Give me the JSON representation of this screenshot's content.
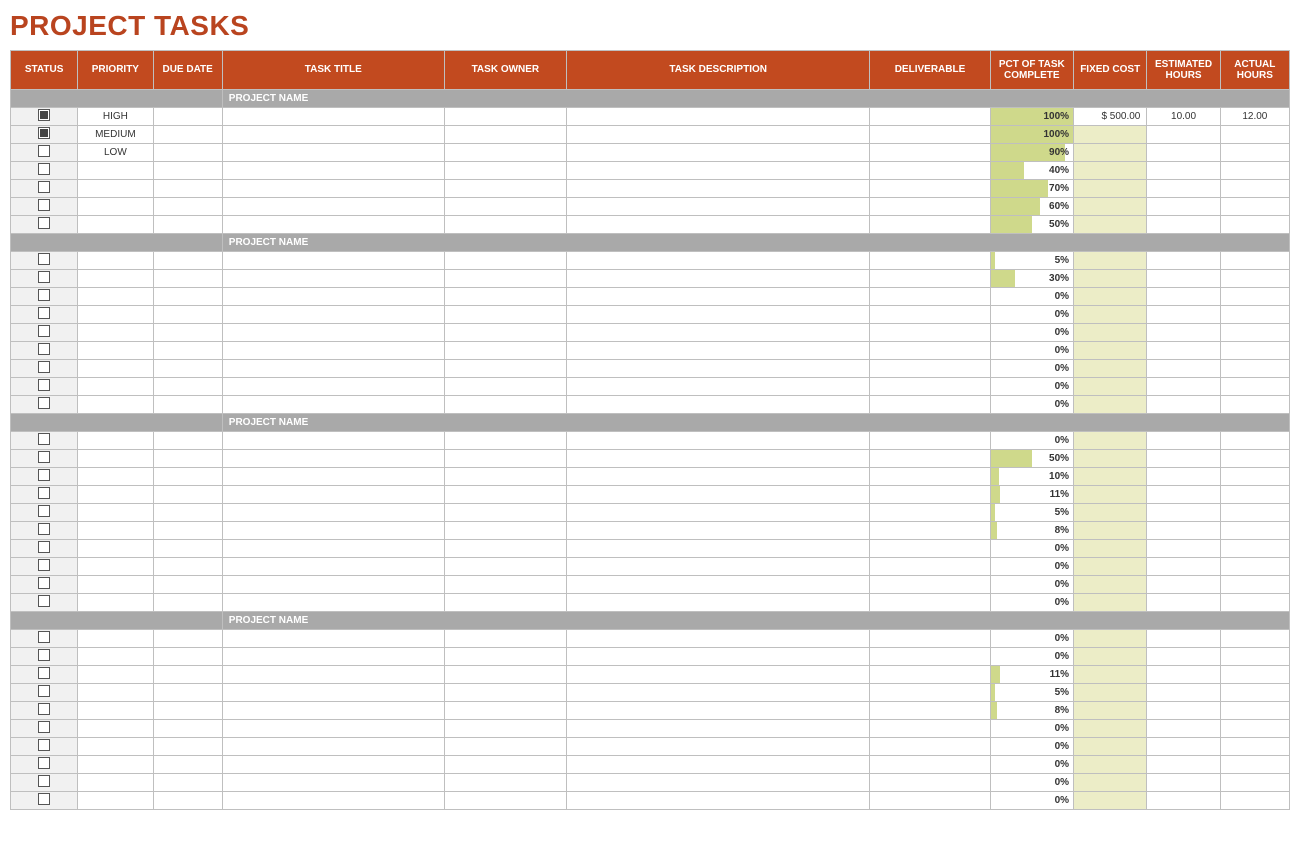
{
  "title": "PROJECT TASKS",
  "columns": {
    "status": "STATUS",
    "priority": "PRIORITY",
    "due_date": "DUE DATE",
    "task_title": "TASK TITLE",
    "task_owner": "TASK OWNER",
    "task_description": "TASK DESCRIPTION",
    "deliverable": "DELIVERABLE",
    "pct_complete": "PCT OF TASK COMPLETE",
    "fixed_cost": "FIXED COST",
    "est_hours": "ESTIMATED HOURS",
    "act_hours": "ACTUAL HOURS"
  },
  "section_label": "PROJECT NAME",
  "sections": [
    {
      "rows": [
        {
          "checked": true,
          "priority": "HIGH",
          "pct": 100,
          "fixed_cost": "$      500.00",
          "est_hours": "10.00",
          "act_hours": "12.00"
        },
        {
          "checked": true,
          "priority": "MEDIUM",
          "pct": 100
        },
        {
          "checked": false,
          "priority": "LOW",
          "pct": 90
        },
        {
          "checked": false,
          "pct": 40
        },
        {
          "checked": false,
          "pct": 70
        },
        {
          "checked": false,
          "pct": 60
        },
        {
          "checked": false,
          "pct": 50
        }
      ]
    },
    {
      "rows": [
        {
          "checked": false,
          "pct": 5
        },
        {
          "checked": false,
          "pct": 30
        },
        {
          "checked": false,
          "pct": 0
        },
        {
          "checked": false,
          "pct": 0
        },
        {
          "checked": false,
          "pct": 0
        },
        {
          "checked": false,
          "pct": 0
        },
        {
          "checked": false,
          "pct": 0
        },
        {
          "checked": false,
          "pct": 0
        },
        {
          "checked": false,
          "pct": 0
        }
      ]
    },
    {
      "rows": [
        {
          "checked": false,
          "pct": 0
        },
        {
          "checked": false,
          "pct": 50
        },
        {
          "checked": false,
          "pct": 10
        },
        {
          "checked": false,
          "pct": 11
        },
        {
          "checked": false,
          "pct": 5
        },
        {
          "checked": false,
          "pct": 8
        },
        {
          "checked": false,
          "pct": 0
        },
        {
          "checked": false,
          "pct": 0
        },
        {
          "checked": false,
          "pct": 0
        },
        {
          "checked": false,
          "pct": 0
        }
      ]
    },
    {
      "rows": [
        {
          "checked": false,
          "pct": 0
        },
        {
          "checked": false,
          "pct": 0
        },
        {
          "checked": false,
          "pct": 11
        },
        {
          "checked": false,
          "pct": 5
        },
        {
          "checked": false,
          "pct": 8
        },
        {
          "checked": false,
          "pct": 0
        },
        {
          "checked": false,
          "pct": 0
        },
        {
          "checked": false,
          "pct": 0
        },
        {
          "checked": false,
          "pct": 0
        },
        {
          "checked": false,
          "pct": 0
        }
      ]
    }
  ]
}
